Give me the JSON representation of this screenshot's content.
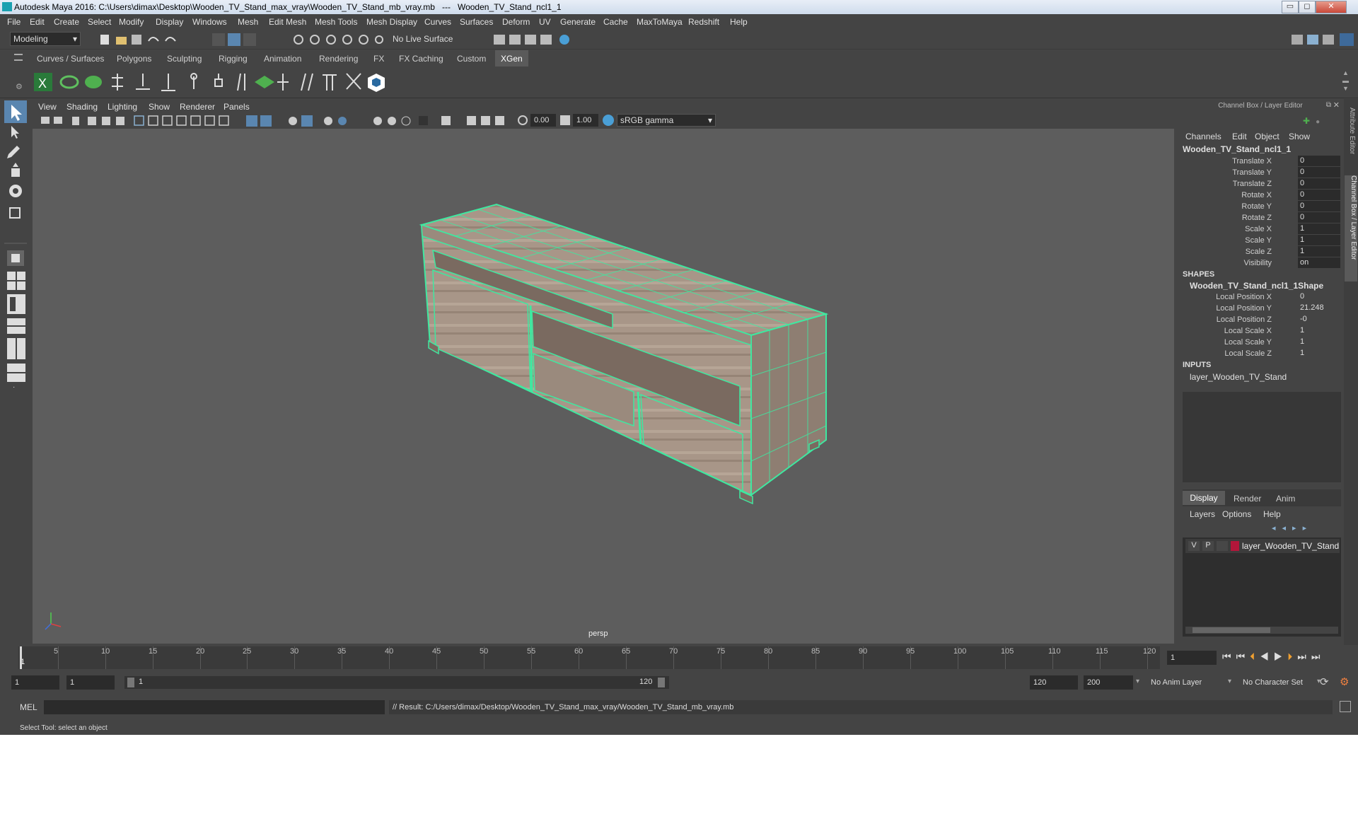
{
  "window": {
    "title": "Autodesk Maya 2016: C:\\Users\\dimax\\Desktop\\Wooden_TV_Stand_max_vray\\Wooden_TV_Stand_mb_vray.mb   ---   Wooden_TV_Stand_ncl1_1",
    "min": "▭",
    "max": "◻",
    "close": "✕"
  },
  "menubar": [
    "File",
    "Edit",
    "Create",
    "Select",
    "Modify",
    "Display",
    "Windows",
    "Mesh",
    "Edit Mesh",
    "Mesh Tools",
    "Mesh Display",
    "Curves",
    "Surfaces",
    "Deform",
    "UV",
    "Generate",
    "Cache",
    "MaxToMaya",
    "Redshift",
    "Help"
  ],
  "statusline": {
    "mode": "Modeling",
    "live_surface": "No Live Surface"
  },
  "shelf_tabs": [
    "Curves / Surfaces",
    "Polygons",
    "Sculpting",
    "Rigging",
    "Animation",
    "Rendering",
    "FX",
    "FX Caching",
    "Custom",
    "XGen"
  ],
  "active_shelf_tab": "XGen",
  "viewport": {
    "menus": [
      "View",
      "Shading",
      "Lighting",
      "Show",
      "Renderer",
      "Panels"
    ],
    "exposure": "0.00",
    "gamma": "1.00",
    "color_space": "sRGB gamma",
    "camera_label": "persp"
  },
  "channel_box": {
    "header": "Channel Box / Layer Editor",
    "menus": [
      "Channels",
      "Edit",
      "Object",
      "Show"
    ],
    "object_name": "Wooden_TV_Stand_ncl1_1",
    "transform_attrs": [
      {
        "name": "Translate X",
        "value": "0"
      },
      {
        "name": "Translate Y",
        "value": "0"
      },
      {
        "name": "Translate Z",
        "value": "0"
      },
      {
        "name": "Rotate X",
        "value": "0"
      },
      {
        "name": "Rotate Y",
        "value": "0"
      },
      {
        "name": "Rotate Z",
        "value": "0"
      },
      {
        "name": "Scale X",
        "value": "1"
      },
      {
        "name": "Scale Y",
        "value": "1"
      },
      {
        "name": "Scale Z",
        "value": "1"
      },
      {
        "name": "Visibility",
        "value": "on"
      }
    ],
    "shapes_label": "SHAPES",
    "shape_name": "Wooden_TV_Stand_ncl1_1Shape",
    "shape_attrs": [
      {
        "name": "Local Position X",
        "value": "0"
      },
      {
        "name": "Local Position Y",
        "value": "21.248"
      },
      {
        "name": "Local Position Z",
        "value": "-0"
      },
      {
        "name": "Local Scale X",
        "value": "1"
      },
      {
        "name": "Local Scale Y",
        "value": "1"
      },
      {
        "name": "Local Scale Z",
        "value": "1"
      }
    ],
    "inputs_label": "INPUTS",
    "input_name": "layer_Wooden_TV_Stand"
  },
  "side_tabs": {
    "attribute_editor": "Attribute Editor",
    "channel_box": "Channel Box / Layer Editor"
  },
  "layer_editor": {
    "tabs": [
      "Display",
      "Render",
      "Anim"
    ],
    "active_tab": "Display",
    "menus": [
      "Layers",
      "Options",
      "Help"
    ],
    "layer": {
      "v": "V",
      "p": "P",
      "name": "layer_Wooden_TV_Stand",
      "color": "#b3163a"
    }
  },
  "timeline": {
    "ticks": [
      "1",
      "5",
      "10",
      "15",
      "20",
      "25",
      "30",
      "35",
      "40",
      "45",
      "50",
      "55",
      "60",
      "65",
      "70",
      "75",
      "80",
      "85",
      "90",
      "95",
      "100",
      "105",
      "110",
      "115",
      "120"
    ],
    "current_frame": "1"
  },
  "range": {
    "start": "1",
    "current": "1",
    "slider_start": "1",
    "slider_end": "120",
    "end": "120",
    "max_end": "200",
    "anim_layer": "No Anim Layer",
    "character_set": "No Character Set"
  },
  "command": {
    "label": "MEL",
    "result": "// Result: C:/Users/dimax/Desktop/Wooden_TV_Stand_max_vray/Wooden_TV_Stand_mb_vray.mb"
  },
  "help_line": "Select Tool: select an object",
  "colors": {
    "wire": "#3fe8a0",
    "accent": "#5aa0d8",
    "tab_active": "#5a5a5a"
  }
}
